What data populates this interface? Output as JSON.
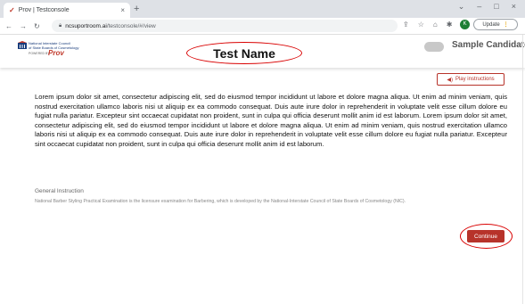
{
  "browser": {
    "tab_title": "Prov | Testconsole",
    "tab_close": "×",
    "new_tab": "+",
    "url_host": "ncsuportroom.ai",
    "url_path": "/testconsole/#/view",
    "update_label": "Update",
    "avatar_letter": "K",
    "window_minimize": "–",
    "window_maximize": "□",
    "window_close": "×",
    "tab_dropdown": "⌄"
  },
  "header": {
    "logo_line1": "National Interstate Council",
    "logo_line2": "of State Boards of Cosmetology",
    "logo_powered": "POWERED BY",
    "logo_prov": "Prov",
    "test_name": "Test Name",
    "candidate_name": "Sample Candidate"
  },
  "instructions": {
    "play_label": "Play instructions",
    "body": "Lorem ipsum dolor sit amet, consectetur adipiscing elit, sed do eiusmod tempor incididunt ut labore et dolore magna aliqua. Ut enim ad minim veniam, quis nostrud exercitation ullamco laboris nisi ut aliquip ex ea commodo consequat. Duis aute irure dolor in reprehenderit in voluptate velit esse cillum dolore eu fugiat nulla pariatur. Excepteur sint occaecat cupidatat non proident, sunt in culpa qui officia deserunt mollit anim id est laborum. Lorem ipsum dolor sit amet, consectetur adipiscing elit, sed do eiusmod tempor incididunt ut labore et dolore magna aliqua. Ut enim ad minim veniam, quis nostrud exercitation ullamco laboris nisi ut aliquip ex ea commodo consequat. Duis aute irure dolor in reprehenderit in voluptate velit esse cillum dolore eu fugiat nulla pariatur. Excepteur sint occaecat cupidatat non proident, sunt in culpa qui officia deserunt mollit anim id est laborum.",
    "general_title": "General Instruction",
    "general_text": "National Barber Styling Practical Examination is the licensure examination for Barbering, which is developed by the National-Interstate Council of State Boards of Cosmetology (NIC).",
    "continue_label": "Continue"
  },
  "colors": {
    "accent": "#b7332a",
    "annotation": "#d90000"
  },
  "icons": [
    "favicon-check-icon",
    "back-icon",
    "forward-icon",
    "reload-icon",
    "lock-icon",
    "share-icon",
    "star-icon",
    "extensions-icon",
    "puzzle-icon",
    "sidepanel-icon",
    "volume-icon",
    "logo-mark-icon"
  ]
}
